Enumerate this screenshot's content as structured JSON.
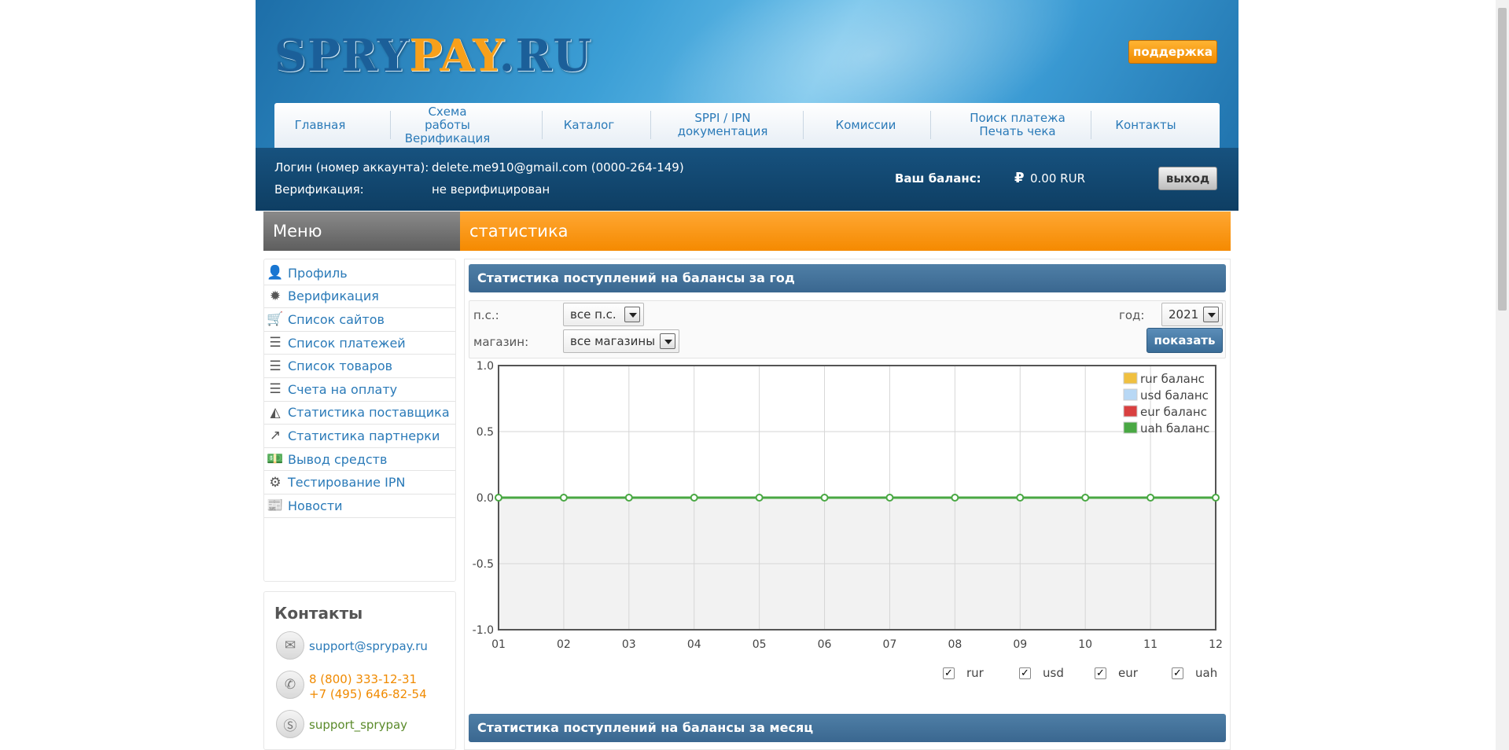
{
  "header": {
    "logo_part1": "SPRY",
    "logo_part2": "PAY",
    "logo_part3": ".RU",
    "support_label": "поддержка"
  },
  "nav": [
    {
      "line1": "Главная",
      "line2": ""
    },
    {
      "line1": "Схема работы",
      "line2": "Верификация"
    },
    {
      "line1": "Каталог",
      "line2": ""
    },
    {
      "line1": "SPPI / IPN",
      "line2": "документация"
    },
    {
      "line1": "Комиссии",
      "line2": ""
    },
    {
      "line1": "Поиск платежа",
      "line2": "Печать чека"
    },
    {
      "line1": "Контакты",
      "line2": ""
    }
  ],
  "account": {
    "login_label": "Логин (номер аккаунта):",
    "login_value": "delete.me910@gmail.com (0000-264-149)",
    "verif_label": "Верификация:",
    "verif_value": "не верифицирован",
    "balance_label": "Ваш баланс:",
    "balance_value": "0.00  RUR",
    "exit_label": "выход"
  },
  "menu_title": "Меню",
  "section_title": "статистика",
  "sidebar": [
    {
      "label": "Профиль",
      "icon": "user-icon",
      "glyph": "👤"
    },
    {
      "label": "Верификация",
      "icon": "badge-icon",
      "glyph": "✹"
    },
    {
      "label": "Список сайтов",
      "icon": "cart-icon",
      "glyph": "🛒"
    },
    {
      "label": "Список платежей",
      "icon": "list-icon",
      "glyph": "☰"
    },
    {
      "label": "Список товаров",
      "icon": "list-icon",
      "glyph": "☰"
    },
    {
      "label": "Счета на оплату",
      "icon": "list-icon",
      "glyph": "☰"
    },
    {
      "label": "Статистика поставщика",
      "icon": "area-chart-icon",
      "glyph": "◭"
    },
    {
      "label": "Статистика партнерки",
      "icon": "line-chart-icon",
      "glyph": "↗"
    },
    {
      "label": "Вывод средств",
      "icon": "money-icon",
      "glyph": "💵"
    },
    {
      "label": "Тестирование IPN",
      "icon": "gears-icon",
      "glyph": "⚙"
    },
    {
      "label": "Новости",
      "icon": "newspaper-icon",
      "glyph": "📰"
    }
  ],
  "contacts": {
    "title": "Контакты",
    "email": "support@sprypay.ru",
    "phone1": "8 (800) 333-12-31",
    "phone2": "+7 (495) 646-82-54",
    "skype": "support_sprypay"
  },
  "panel_year_title": "Статистика поступлений на балансы за год",
  "panel_month_title": "Статистика поступлений на балансы за месяц",
  "filters": {
    "ps_label": "п.с.:",
    "ps_value": "все п.с.",
    "year_label": "год:",
    "year_value": "2021",
    "shop_label": "магазин:",
    "shop_value": "все магазины",
    "show_label": "показать"
  },
  "colors": {
    "rur": "#f0c040",
    "usd": "#b8d8f5",
    "eur": "#d94040",
    "uah": "#49a843"
  },
  "chart_data": {
    "type": "line",
    "x": [
      "01",
      "02",
      "03",
      "04",
      "05",
      "06",
      "07",
      "08",
      "09",
      "10",
      "11",
      "12"
    ],
    "ylim": [
      -1.0,
      1.0
    ],
    "yticks": [
      "1.0",
      "0.5",
      "0.0",
      "-0.5",
      "-1.0"
    ],
    "grid": true,
    "legend_position": "top-right",
    "series": [
      {
        "name": "rur баланс",
        "values": [
          0,
          0,
          0,
          0,
          0,
          0,
          0,
          0,
          0,
          0,
          0,
          0
        ]
      },
      {
        "name": "usd баланс",
        "values": [
          0,
          0,
          0,
          0,
          0,
          0,
          0,
          0,
          0,
          0,
          0,
          0
        ]
      },
      {
        "name": "eur баланс",
        "values": [
          0,
          0,
          0,
          0,
          0,
          0,
          0,
          0,
          0,
          0,
          0,
          0
        ]
      },
      {
        "name": "uah баланс",
        "values": [
          0,
          0,
          0,
          0,
          0,
          0,
          0,
          0,
          0,
          0,
          0,
          0
        ]
      }
    ]
  },
  "series_toggles": [
    {
      "label": "rur",
      "checked": true
    },
    {
      "label": "usd",
      "checked": true
    },
    {
      "label": "eur",
      "checked": true
    },
    {
      "label": "uah",
      "checked": true
    }
  ],
  "checkmark": "✓"
}
